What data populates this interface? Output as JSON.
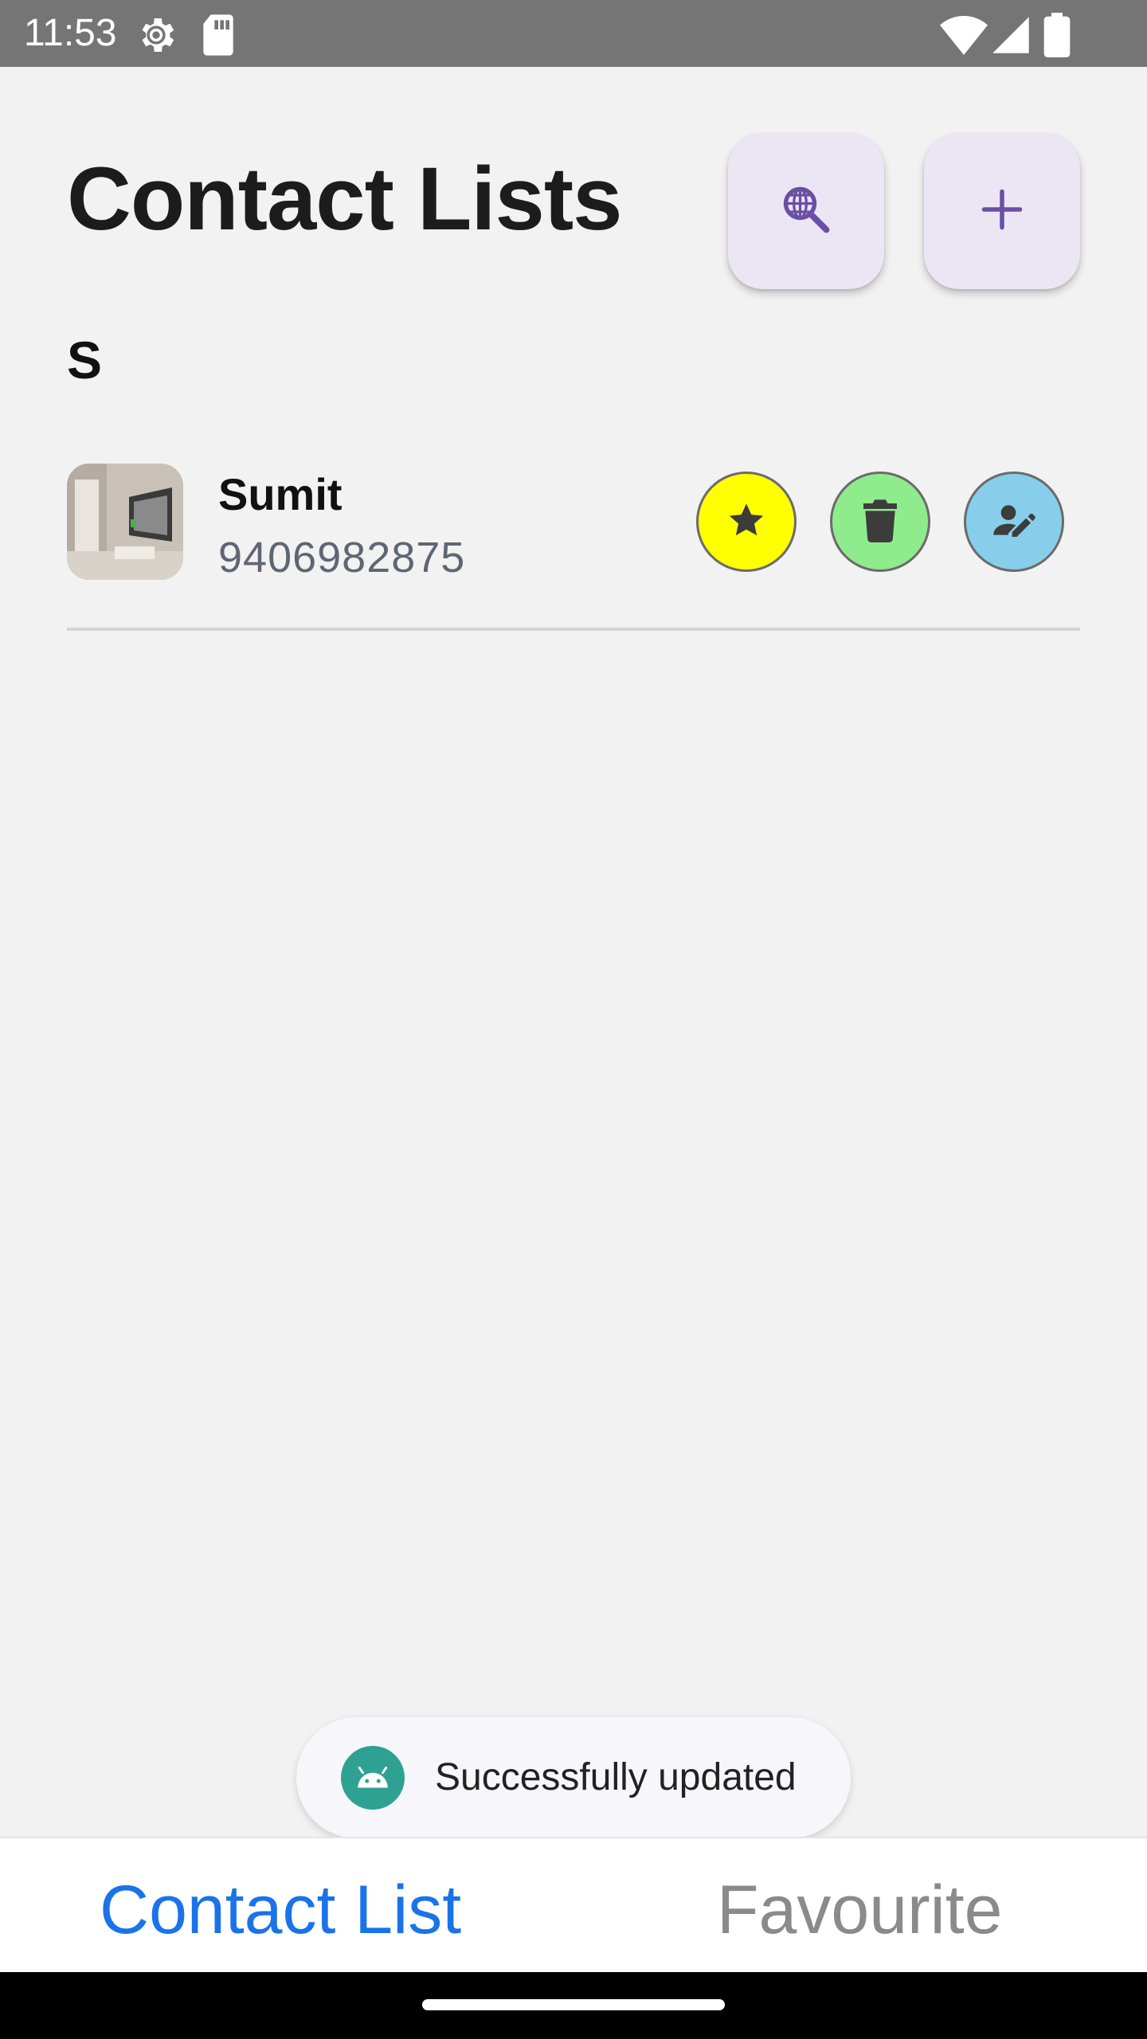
{
  "status_bar": {
    "time": "11:53",
    "icons": [
      "settings-gear-icon",
      "sd-card-icon",
      "wifi-icon",
      "cell-signal-icon",
      "battery-icon"
    ]
  },
  "header": {
    "title": "Contact Lists",
    "search_button_icon": "globe-search-icon",
    "add_button_icon": "plus-icon",
    "accent_color": "#6a4fa3"
  },
  "sections": [
    {
      "letter": "S",
      "contacts": [
        {
          "name": "Sumit",
          "phone": "9406982875",
          "actions": [
            {
              "name": "favourite",
              "icon": "star-icon",
              "color": "#ffff00"
            },
            {
              "name": "delete",
              "icon": "trash-icon",
              "color": "#8fec8c"
            },
            {
              "name": "edit",
              "icon": "edit-person-icon",
              "color": "#87ceeb"
            }
          ]
        }
      ]
    }
  ],
  "toast": {
    "icon": "android-icon",
    "message": "Successfully updated"
  },
  "bottom_nav": {
    "tabs": [
      {
        "label": "Contact List",
        "active": true,
        "color": "#1a73e8"
      },
      {
        "label": "Favourite",
        "active": false,
        "color": "#8a8a8a"
      }
    ]
  }
}
